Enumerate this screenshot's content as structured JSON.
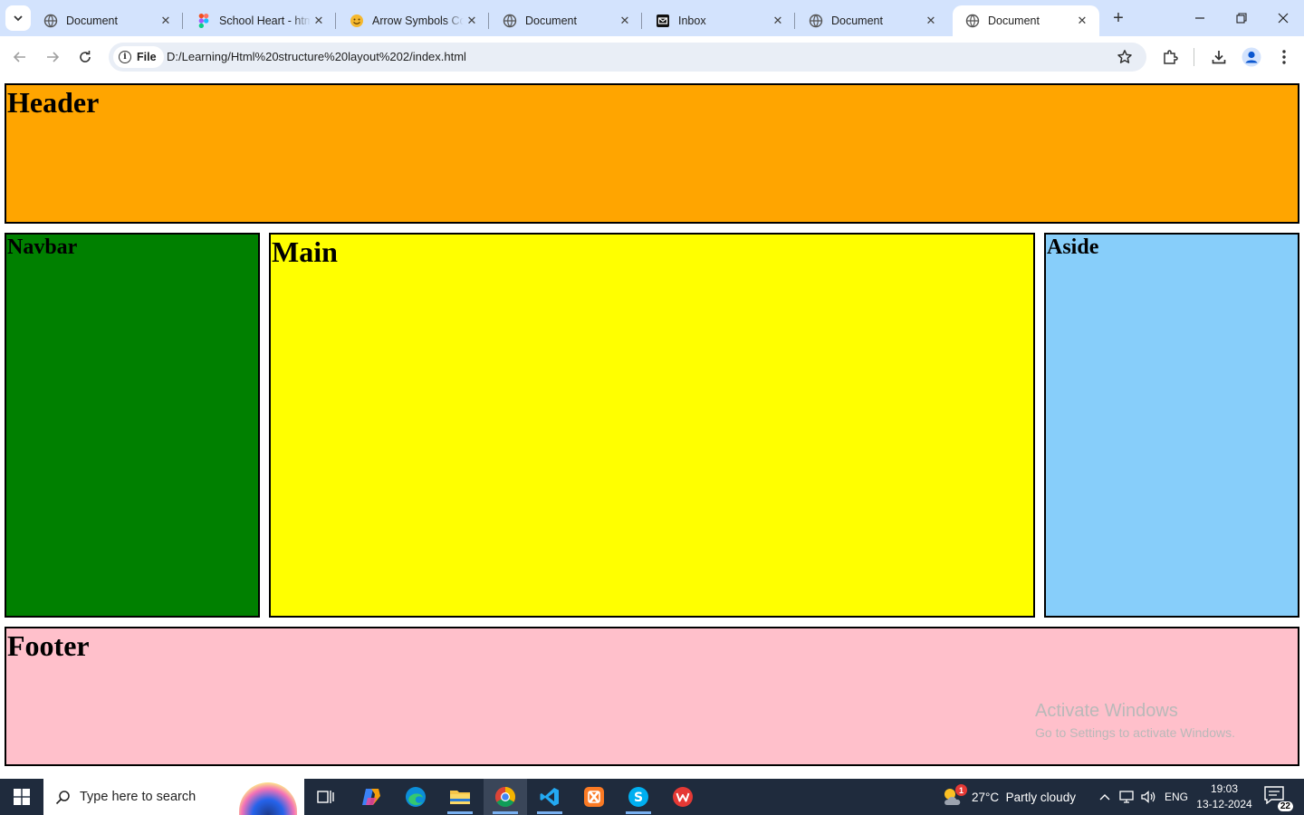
{
  "browser": {
    "tabs": [
      {
        "title": "Document",
        "icon": "globe-icon",
        "active": false
      },
      {
        "title": "School Heart - htm",
        "icon": "figma-icon",
        "active": false
      },
      {
        "title": "Arrow Symbols Co",
        "icon": "emoji-icon",
        "active": false
      },
      {
        "title": "Document",
        "icon": "globe-icon",
        "active": false
      },
      {
        "title": "Inbox",
        "icon": "mail-icon",
        "active": false
      },
      {
        "title": "Document",
        "icon": "globe-icon",
        "active": false
      },
      {
        "title": "Document",
        "icon": "globe-icon",
        "active": true
      }
    ],
    "new_tab_label": "+",
    "scheme_label": "File",
    "url": "D:/Learning/Html%20structure%20layout%202/index.html"
  },
  "page": {
    "header": {
      "label": "Header",
      "color": "#ffa500"
    },
    "navbar": {
      "label": "Navbar",
      "color": "#008000"
    },
    "main": {
      "label": "Main",
      "color": "#ffff00"
    },
    "aside": {
      "label": "Aside",
      "color": "#87cefa"
    },
    "footer": {
      "label": "Footer",
      "color": "#ffc0cb"
    }
  },
  "watermark": {
    "line1": "Activate Windows",
    "line2": "Go to Settings to activate Windows."
  },
  "taskbar": {
    "search_placeholder": "Type here to search",
    "weather": "27°C  Partly cloudy",
    "weather_badge": "1",
    "language": "ENG",
    "time": "19:03",
    "date": "13-12-2024",
    "notification_count": "22"
  }
}
